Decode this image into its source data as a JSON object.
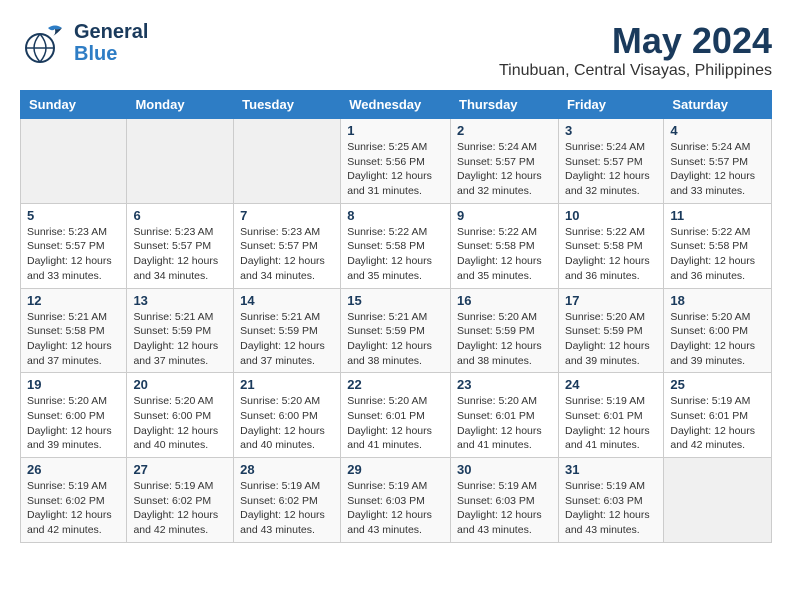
{
  "header": {
    "logo_line1": "General",
    "logo_line2": "Blue",
    "month": "May 2024",
    "location": "Tinubuan, Central Visayas, Philippines"
  },
  "weekdays": [
    "Sunday",
    "Monday",
    "Tuesday",
    "Wednesday",
    "Thursday",
    "Friday",
    "Saturday"
  ],
  "weeks": [
    [
      {
        "day": "",
        "sunrise": "",
        "sunset": "",
        "daylight": ""
      },
      {
        "day": "",
        "sunrise": "",
        "sunset": "",
        "daylight": ""
      },
      {
        "day": "",
        "sunrise": "",
        "sunset": "",
        "daylight": ""
      },
      {
        "day": "1",
        "sunrise": "Sunrise: 5:25 AM",
        "sunset": "Sunset: 5:56 PM",
        "daylight": "Daylight: 12 hours and 31 minutes."
      },
      {
        "day": "2",
        "sunrise": "Sunrise: 5:24 AM",
        "sunset": "Sunset: 5:57 PM",
        "daylight": "Daylight: 12 hours and 32 minutes."
      },
      {
        "day": "3",
        "sunrise": "Sunrise: 5:24 AM",
        "sunset": "Sunset: 5:57 PM",
        "daylight": "Daylight: 12 hours and 32 minutes."
      },
      {
        "day": "4",
        "sunrise": "Sunrise: 5:24 AM",
        "sunset": "Sunset: 5:57 PM",
        "daylight": "Daylight: 12 hours and 33 minutes."
      }
    ],
    [
      {
        "day": "5",
        "sunrise": "Sunrise: 5:23 AM",
        "sunset": "Sunset: 5:57 PM",
        "daylight": "Daylight: 12 hours and 33 minutes."
      },
      {
        "day": "6",
        "sunrise": "Sunrise: 5:23 AM",
        "sunset": "Sunset: 5:57 PM",
        "daylight": "Daylight: 12 hours and 34 minutes."
      },
      {
        "day": "7",
        "sunrise": "Sunrise: 5:23 AM",
        "sunset": "Sunset: 5:57 PM",
        "daylight": "Daylight: 12 hours and 34 minutes."
      },
      {
        "day": "8",
        "sunrise": "Sunrise: 5:22 AM",
        "sunset": "Sunset: 5:58 PM",
        "daylight": "Daylight: 12 hours and 35 minutes."
      },
      {
        "day": "9",
        "sunrise": "Sunrise: 5:22 AM",
        "sunset": "Sunset: 5:58 PM",
        "daylight": "Daylight: 12 hours and 35 minutes."
      },
      {
        "day": "10",
        "sunrise": "Sunrise: 5:22 AM",
        "sunset": "Sunset: 5:58 PM",
        "daylight": "Daylight: 12 hours and 36 minutes."
      },
      {
        "day": "11",
        "sunrise": "Sunrise: 5:22 AM",
        "sunset": "Sunset: 5:58 PM",
        "daylight": "Daylight: 12 hours and 36 minutes."
      }
    ],
    [
      {
        "day": "12",
        "sunrise": "Sunrise: 5:21 AM",
        "sunset": "Sunset: 5:58 PM",
        "daylight": "Daylight: 12 hours and 37 minutes."
      },
      {
        "day": "13",
        "sunrise": "Sunrise: 5:21 AM",
        "sunset": "Sunset: 5:59 PM",
        "daylight": "Daylight: 12 hours and 37 minutes."
      },
      {
        "day": "14",
        "sunrise": "Sunrise: 5:21 AM",
        "sunset": "Sunset: 5:59 PM",
        "daylight": "Daylight: 12 hours and 37 minutes."
      },
      {
        "day": "15",
        "sunrise": "Sunrise: 5:21 AM",
        "sunset": "Sunset: 5:59 PM",
        "daylight": "Daylight: 12 hours and 38 minutes."
      },
      {
        "day": "16",
        "sunrise": "Sunrise: 5:20 AM",
        "sunset": "Sunset: 5:59 PM",
        "daylight": "Daylight: 12 hours and 38 minutes."
      },
      {
        "day": "17",
        "sunrise": "Sunrise: 5:20 AM",
        "sunset": "Sunset: 5:59 PM",
        "daylight": "Daylight: 12 hours and 39 minutes."
      },
      {
        "day": "18",
        "sunrise": "Sunrise: 5:20 AM",
        "sunset": "Sunset: 6:00 PM",
        "daylight": "Daylight: 12 hours and 39 minutes."
      }
    ],
    [
      {
        "day": "19",
        "sunrise": "Sunrise: 5:20 AM",
        "sunset": "Sunset: 6:00 PM",
        "daylight": "Daylight: 12 hours and 39 minutes."
      },
      {
        "day": "20",
        "sunrise": "Sunrise: 5:20 AM",
        "sunset": "Sunset: 6:00 PM",
        "daylight": "Daylight: 12 hours and 40 minutes."
      },
      {
        "day": "21",
        "sunrise": "Sunrise: 5:20 AM",
        "sunset": "Sunset: 6:00 PM",
        "daylight": "Daylight: 12 hours and 40 minutes."
      },
      {
        "day": "22",
        "sunrise": "Sunrise: 5:20 AM",
        "sunset": "Sunset: 6:01 PM",
        "daylight": "Daylight: 12 hours and 41 minutes."
      },
      {
        "day": "23",
        "sunrise": "Sunrise: 5:20 AM",
        "sunset": "Sunset: 6:01 PM",
        "daylight": "Daylight: 12 hours and 41 minutes."
      },
      {
        "day": "24",
        "sunrise": "Sunrise: 5:19 AM",
        "sunset": "Sunset: 6:01 PM",
        "daylight": "Daylight: 12 hours and 41 minutes."
      },
      {
        "day": "25",
        "sunrise": "Sunrise: 5:19 AM",
        "sunset": "Sunset: 6:01 PM",
        "daylight": "Daylight: 12 hours and 42 minutes."
      }
    ],
    [
      {
        "day": "26",
        "sunrise": "Sunrise: 5:19 AM",
        "sunset": "Sunset: 6:02 PM",
        "daylight": "Daylight: 12 hours and 42 minutes."
      },
      {
        "day": "27",
        "sunrise": "Sunrise: 5:19 AM",
        "sunset": "Sunset: 6:02 PM",
        "daylight": "Daylight: 12 hours and 42 minutes."
      },
      {
        "day": "28",
        "sunrise": "Sunrise: 5:19 AM",
        "sunset": "Sunset: 6:02 PM",
        "daylight": "Daylight: 12 hours and 43 minutes."
      },
      {
        "day": "29",
        "sunrise": "Sunrise: 5:19 AM",
        "sunset": "Sunset: 6:03 PM",
        "daylight": "Daylight: 12 hours and 43 minutes."
      },
      {
        "day": "30",
        "sunrise": "Sunrise: 5:19 AM",
        "sunset": "Sunset: 6:03 PM",
        "daylight": "Daylight: 12 hours and 43 minutes."
      },
      {
        "day": "31",
        "sunrise": "Sunrise: 5:19 AM",
        "sunset": "Sunset: 6:03 PM",
        "daylight": "Daylight: 12 hours and 43 minutes."
      },
      {
        "day": "",
        "sunrise": "",
        "sunset": "",
        "daylight": ""
      }
    ]
  ]
}
